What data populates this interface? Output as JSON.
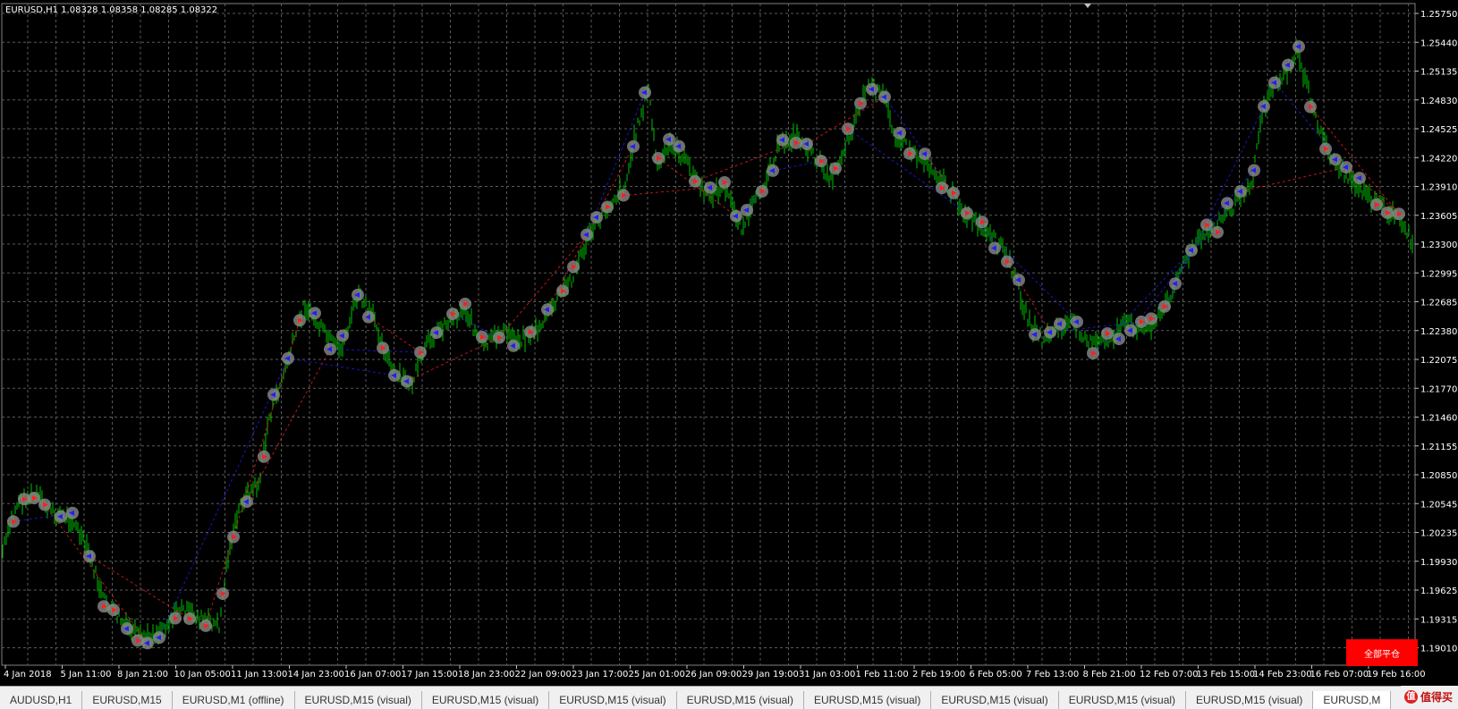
{
  "chart": {
    "symbol_info": "EURUSD,H1  1.08328 1.08358 1.08285 1.08322",
    "price_labels": [
      "1.25750",
      "1.25440",
      "1.25135",
      "1.24830",
      "1.24525",
      "1.24220",
      "1.23910",
      "1.23605",
      "1.23300",
      "1.22995",
      "1.22685",
      "1.22380",
      "1.22075",
      "1.21770",
      "1.21460",
      "1.21155",
      "1.20850",
      "1.20545",
      "1.20235",
      "1.19930",
      "1.19625",
      "1.19315",
      "1.19010"
    ],
    "time_labels": [
      "4 Jan 2018",
      "5 Jan 11:00",
      "8 Jan 21:00",
      "10 Jan 05:00",
      "11 Jan 13:00",
      "14 Jan 23:00",
      "16 Jan 07:00",
      "17 Jan 15:00",
      "18 Jan 23:00",
      "22 Jan 09:00",
      "23 Jan 17:00",
      "25 Jan 01:00",
      "26 Jan 09:00",
      "29 Jan 19:00",
      "31 Jan 03:00",
      "1 Feb 11:00",
      "2 Feb 19:00",
      "6 Feb 05:00",
      "7 Feb 13:00",
      "8 Feb 21:00",
      "12 Feb 07:00",
      "13 Feb 15:00",
      "14 Feb 23:00",
      "16 Feb 07:00",
      "19 Feb 16:00"
    ],
    "colors": {
      "background": "#000000",
      "grid": "#5a5a5a",
      "candles": "#00c000",
      "buy_link": "#2020ff",
      "sell_link": "#ff2020",
      "marker_ring": "#8a8a8a"
    },
    "close_all_label": "全部平仓"
  },
  "tabs": [
    {
      "label": "AUDUSD,H1",
      "active": false
    },
    {
      "label": "EURUSD,M15",
      "active": false
    },
    {
      "label": "EURUSD,M1 (offline)",
      "active": false
    },
    {
      "label": "EURUSD,M15 (visual)",
      "active": false
    },
    {
      "label": "EURUSD,M15 (visual)",
      "active": false
    },
    {
      "label": "EURUSD,M15 (visual)",
      "active": false
    },
    {
      "label": "EURUSD,M15 (visual)",
      "active": false
    },
    {
      "label": "EURUSD,M15 (visual)",
      "active": false
    },
    {
      "label": "EURUSD,M15 (visual)",
      "active": false
    },
    {
      "label": "EURUSD,M15 (visual)",
      "active": false
    },
    {
      "label": "EURUSD,M15 (visual)",
      "active": false
    },
    {
      "label": "EURUSD,M",
      "active": true
    }
  ],
  "watermark": {
    "text": "值得买"
  }
}
